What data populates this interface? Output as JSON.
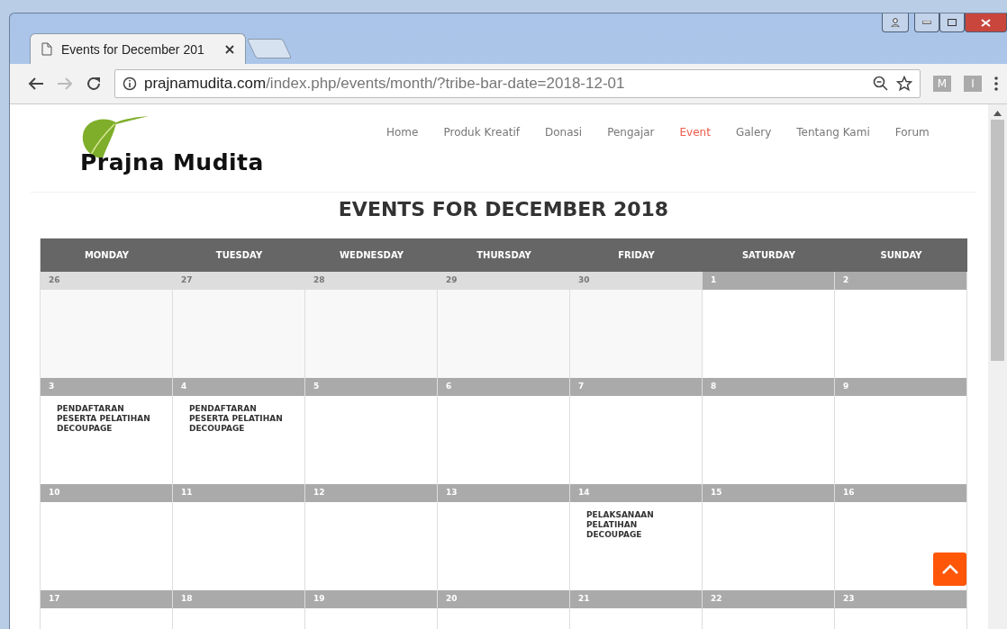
{
  "browser": {
    "tab_title": "Events for December 201",
    "url_domain": "prajnamudita.com",
    "url_path": "/index.php/events/month/?tribe-bar-date=2018-12-01",
    "extensions": [
      "M",
      "I"
    ]
  },
  "site": {
    "logo_text": "Prajna Mudita",
    "nav": [
      {
        "label": "Home",
        "selected": false
      },
      {
        "label": "Produk Kreatif",
        "selected": false
      },
      {
        "label": "Donasi",
        "selected": false
      },
      {
        "label": "Pengajar",
        "selected": false
      },
      {
        "label": "Event",
        "selected": true
      },
      {
        "label": "Galery",
        "selected": false
      },
      {
        "label": "Tentang Kami",
        "selected": false
      },
      {
        "label": "Forum",
        "selected": false
      }
    ]
  },
  "calendar": {
    "heading": "EVENTS FOR DECEMBER 2018",
    "weekdays": [
      "MONDAY",
      "TUESDAY",
      "WEDNESDAY",
      "THURSDAY",
      "FRIDAY",
      "SATURDAY",
      "SUNDAY"
    ],
    "weeks": [
      {
        "days": [
          {
            "date": "26",
            "other_month": true
          },
          {
            "date": "27",
            "other_month": true
          },
          {
            "date": "28",
            "other_month": true
          },
          {
            "date": "29",
            "other_month": true
          },
          {
            "date": "30",
            "other_month": true
          },
          {
            "date": "1",
            "other_month": false
          },
          {
            "date": "2",
            "other_month": false
          }
        ]
      },
      {
        "days": [
          {
            "date": "3",
            "other_month": false,
            "events": [
              "PENDAFTARAN PESERTA PELATIHAN DECOUPAGE"
            ]
          },
          {
            "date": "4",
            "other_month": false,
            "events": [
              "PENDAFTARAN PESERTA PELATIHAN DECOUPAGE"
            ]
          },
          {
            "date": "5",
            "other_month": false
          },
          {
            "date": "6",
            "other_month": false
          },
          {
            "date": "7",
            "other_month": false
          },
          {
            "date": "8",
            "other_month": false
          },
          {
            "date": "9",
            "other_month": false
          }
        ]
      },
      {
        "days": [
          {
            "date": "10",
            "other_month": false
          },
          {
            "date": "11",
            "other_month": false
          },
          {
            "date": "12",
            "other_month": false
          },
          {
            "date": "13",
            "other_month": false
          },
          {
            "date": "14",
            "other_month": false,
            "events": [
              "PELAKSANAAN PELATIHAN DECOUPAGE"
            ]
          },
          {
            "date": "15",
            "other_month": false
          },
          {
            "date": "16",
            "other_month": false
          }
        ]
      },
      {
        "days": [
          {
            "date": "17",
            "other_month": false
          },
          {
            "date": "18",
            "other_month": false
          },
          {
            "date": "19",
            "other_month": false
          },
          {
            "date": "20",
            "other_month": false
          },
          {
            "date": "21",
            "other_month": false
          },
          {
            "date": "22",
            "other_month": false
          },
          {
            "date": "23",
            "other_month": false
          }
        ]
      }
    ]
  }
}
